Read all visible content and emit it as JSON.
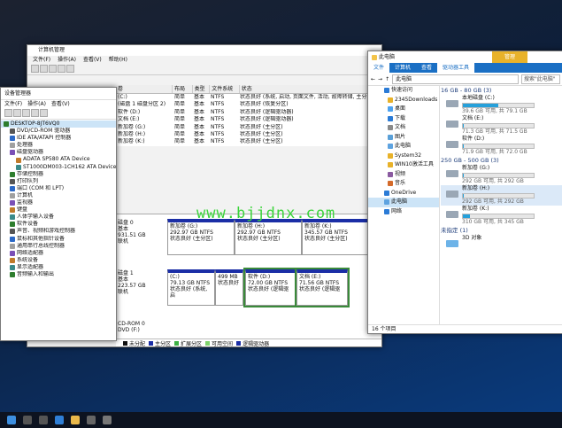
{
  "computer_management": {
    "title": "计算机管理",
    "menu": [
      "文件(F)",
      "操作(A)",
      "查看(V)",
      "帮助(H)"
    ],
    "columns": [
      "卷",
      "布局",
      "类型",
      "文件系统",
      "状态"
    ],
    "volumes": [
      {
        "name": "(C:)",
        "layout": "简单",
        "type": "基本",
        "fs": "NTFS",
        "status": "状态良好 (系统, 启动, 页面文件, 活动, 故障转储, 主分区)"
      },
      {
        "name": "(磁盘 1 磁盘分区 2)",
        "layout": "简单",
        "type": "基本",
        "fs": "NTFS",
        "status": "状态良好 (恢复分区)"
      },
      {
        "name": "软件 (D:)",
        "layout": "简单",
        "type": "基本",
        "fs": "NTFS",
        "status": "状态良好 (逻辑驱动器)"
      },
      {
        "name": "文档 (E:)",
        "layout": "简单",
        "type": "基本",
        "fs": "NTFS",
        "status": "状态良好 (逻辑驱动器)"
      },
      {
        "name": "新加卷 (G:)",
        "layout": "简单",
        "type": "基本",
        "fs": "NTFS",
        "status": "状态良好 (主分区)"
      },
      {
        "name": "新加卷 (H:)",
        "layout": "简单",
        "type": "基本",
        "fs": "NTFS",
        "status": "状态良好 (主分区)"
      },
      {
        "name": "新加卷 (K:)",
        "layout": "简单",
        "type": "基本",
        "fs": "NTFS",
        "status": "状态良好 (主分区)"
      }
    ],
    "disk0": {
      "name": "磁盘 0",
      "type": "基本",
      "size": "931.51 GB",
      "state": "联机",
      "parts": [
        {
          "name": "新加卷 (G:)",
          "size": "292.97 GB NTFS",
          "status": "状态良好 (主分区)"
        },
        {
          "name": "新加卷 (H:)",
          "size": "292.97 GB NTFS",
          "status": "状态良好 (主分区)"
        },
        {
          "name": "新加卷 (K:)",
          "size": "345.57 GB NTFS",
          "status": "状态良好 (主分区)"
        }
      ]
    },
    "disk1": {
      "name": "磁盘 1",
      "type": "基本",
      "size": "223.57 GB",
      "state": "联机",
      "parts": [
        {
          "name": "(C:)",
          "size": "79.13 GB NTFS",
          "status": "状态良好 (系统, 启"
        },
        {
          "name": "",
          "size": "499 MB",
          "status": "状态良好"
        },
        {
          "name": "软件 (D:)",
          "size": "72.00 GB NTFS",
          "status": "状态良好 (逻辑驱"
        },
        {
          "name": "文档 (E:)",
          "size": "71.56 GB NTFS",
          "status": "状态良好 (逻辑驱"
        }
      ]
    },
    "cdrom": {
      "name": "CD-ROM 0",
      "type": "DVD (F:)"
    },
    "legend": [
      {
        "label": "未分配",
        "color": "#111111"
      },
      {
        "label": "主分区",
        "color": "#1b2ea6"
      },
      {
        "label": "扩展分区",
        "color": "#3cb043"
      },
      {
        "label": "可用空间",
        "color": "#7fd36b"
      },
      {
        "label": "逻辑驱动器",
        "color": "#1b2ea6"
      }
    ]
  },
  "device_manager": {
    "title": "设备管理器",
    "menu": [
      "文件(F)",
      "操作(A)",
      "查看(V)"
    ],
    "tree": [
      {
        "label": "DESKTOP-8JT6VQ0",
        "level": 0,
        "sel": true
      },
      {
        "label": "DVD/CD-ROM 驱动器",
        "level": 1
      },
      {
        "label": "IDE ATA/ATAPI 控制器",
        "level": 1
      },
      {
        "label": "处理器",
        "level": 1
      },
      {
        "label": "磁盘驱动器",
        "level": 1
      },
      {
        "label": "ADATA SP580 ATA Device",
        "level": 2
      },
      {
        "label": "ST1000DM003-1CH162 ATA Device",
        "level": 2
      },
      {
        "label": "存储控制器",
        "level": 1
      },
      {
        "label": "打印队列",
        "level": 1
      },
      {
        "label": "端口 (COM 和 LPT)",
        "level": 1
      },
      {
        "label": "计算机",
        "level": 1
      },
      {
        "label": "监视器",
        "level": 1
      },
      {
        "label": "键盘",
        "level": 1
      },
      {
        "label": "人体学输入设备",
        "level": 1
      },
      {
        "label": "软件设备",
        "level": 1
      },
      {
        "label": "声音、视频和游戏控制器",
        "level": 1
      },
      {
        "label": "鼠标和其他指针设备",
        "level": 1
      },
      {
        "label": "通用串行总线控制器",
        "level": 1
      },
      {
        "label": "网络适配器",
        "level": 1
      },
      {
        "label": "系统设备",
        "level": 1
      },
      {
        "label": "显示适配器",
        "level": 1
      },
      {
        "label": "音频输入和输出",
        "level": 1
      }
    ]
  },
  "file_explorer": {
    "title": "此电脑",
    "ribbon_tool": "驱动器工具",
    "ribbon_manage": "管理",
    "tabs": [
      "文件",
      "计算机",
      "查看"
    ],
    "address": "此电脑",
    "search_placeholder": "搜索\"此电脑\"",
    "nav": [
      {
        "label": "快速访问",
        "sub": false
      },
      {
        "label": "2345Downloads",
        "sub": true
      },
      {
        "label": "桌面",
        "sub": true
      },
      {
        "label": "下载",
        "sub": true
      },
      {
        "label": "文档",
        "sub": true
      },
      {
        "label": "图片",
        "sub": true
      },
      {
        "label": "此电脑",
        "sub": true
      },
      {
        "label": "System32",
        "sub": true
      },
      {
        "label": "WIN10激活工具",
        "sub": true
      },
      {
        "label": "视频",
        "sub": true
      },
      {
        "label": "音乐",
        "sub": true
      },
      {
        "label": "OneDrive",
        "sub": false
      },
      {
        "label": "此电脑",
        "sub": false,
        "sel": true
      },
      {
        "label": "网络",
        "sub": false
      }
    ],
    "groups": [
      {
        "header": "16 GB - 80 GB (3)",
        "drives": [
          {
            "name": "本地磁盘 (C:)",
            "free": "39.6 GB 可用, 共 79.1 GB",
            "used_pct": 50
          },
          {
            "name": "文档 (E:)",
            "free": "71.3 GB 可用, 共 71.5 GB",
            "used_pct": 1
          },
          {
            "name": "软件 (D:)",
            "free": "71.9 GB 可用, 共 72.0 GB",
            "used_pct": 1
          }
        ]
      },
      {
        "header": "250 GB - 500 GB (3)",
        "drives": [
          {
            "name": "新加卷 (G:)",
            "free": "292 GB 可用, 共 292 GB",
            "used_pct": 1
          },
          {
            "name": "新加卷 (H:)",
            "free": "292 GB 可用, 共 292 GB",
            "used_pct": 1,
            "sel": true
          },
          {
            "name": "新加卷 (K:)",
            "free": "310 GB 可用, 共 345 GB",
            "used_pct": 10
          }
        ]
      },
      {
        "header": "未指定 (1)",
        "drives": [
          {
            "name": "3D 对象",
            "free": "",
            "used_pct": null
          }
        ]
      }
    ],
    "status": "16 个项目"
  },
  "watermark": "www.bjjdnx.com",
  "colors": {
    "accent": "#1a6fc4",
    "primary_part": "#1b2ea6",
    "watermark": "#3ad43a"
  }
}
